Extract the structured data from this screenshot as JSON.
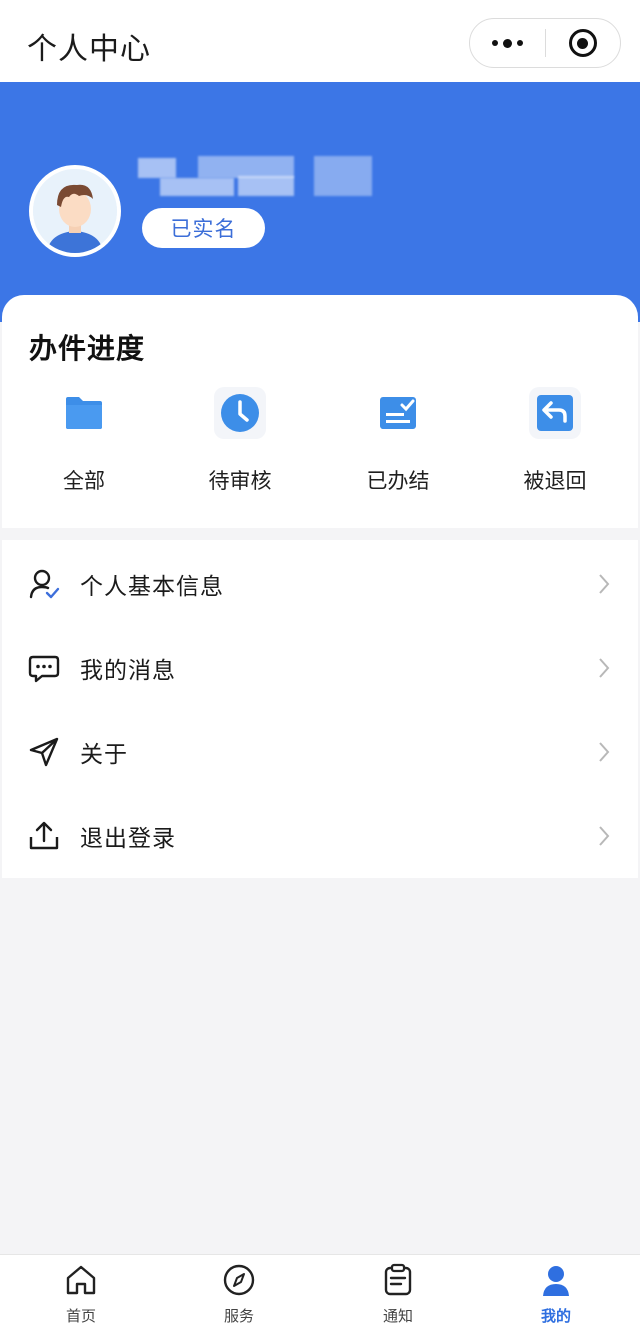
{
  "header": {
    "title": "个人中心",
    "more_icon": "more-dots-icon",
    "close_icon": "target-circle-icon"
  },
  "profile": {
    "avatar_icon": "avatar-boy-icon",
    "verified_badge": "已实名"
  },
  "progress": {
    "title": "办件进度",
    "items": [
      {
        "label": "全部",
        "icon": "folder-icon"
      },
      {
        "label": "待审核",
        "icon": "clock-icon"
      },
      {
        "label": "已办结",
        "icon": "checklist-icon"
      },
      {
        "label": "被退回",
        "icon": "return-arrow-icon"
      }
    ]
  },
  "menu": {
    "items": [
      {
        "label": "个人基本信息",
        "icon": "user-check-icon"
      },
      {
        "label": "我的消息",
        "icon": "chat-bubble-icon"
      },
      {
        "label": "关于",
        "icon": "send-arrow-icon"
      },
      {
        "label": "退出登录",
        "icon": "upload-icon"
      }
    ]
  },
  "tabbar": {
    "items": [
      {
        "label": "首页",
        "icon": "home-icon",
        "active": false
      },
      {
        "label": "服务",
        "icon": "compass-icon",
        "active": false
      },
      {
        "label": "通知",
        "icon": "clipboard-icon",
        "active": false
      },
      {
        "label": "我的",
        "icon": "person-icon",
        "active": true
      }
    ]
  },
  "colors": {
    "brand_blue": "#3c76e6",
    "icon_blue": "#3d8ee8",
    "active_tab": "#2f6fe0"
  }
}
